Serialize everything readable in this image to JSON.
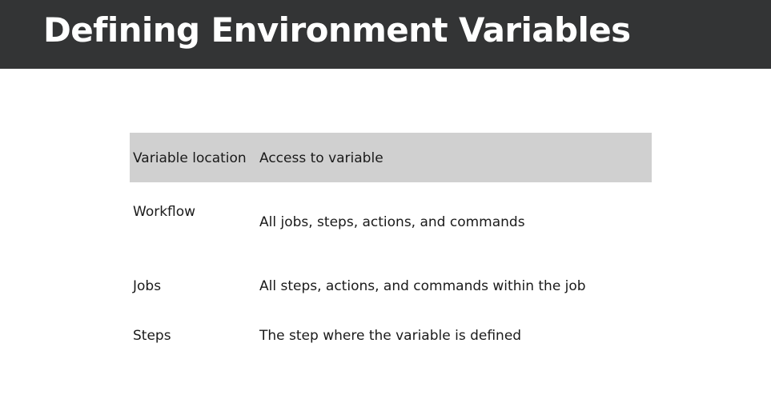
{
  "slide": {
    "title": "Defining Environment Variables"
  },
  "table": {
    "headers": [
      "Variable location",
      "Access to variable"
    ],
    "rows": [
      {
        "location": "Workflow",
        "access": "All jobs, steps, actions, and commands"
      },
      {
        "location": "Jobs",
        "access": "All steps, actions, and commands within the job"
      },
      {
        "location": "Steps",
        "access": "The step where the variable is defined"
      }
    ]
  },
  "colors": {
    "header_bar": "#333435",
    "title_text": "#ffffff",
    "table_header_bg": "#d0d0d0",
    "body_text": "#1a1a1a"
  }
}
